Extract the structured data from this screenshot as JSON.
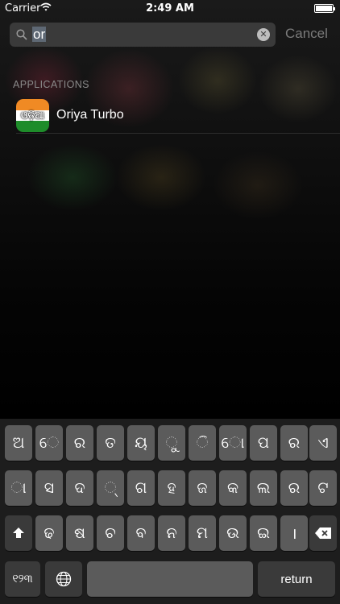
{
  "status_bar": {
    "carrier": "Carrier",
    "time": "2:49 AM"
  },
  "search": {
    "query": "or",
    "cancel_label": "Cancel"
  },
  "results": {
    "section_header": "APPLICATIONS",
    "items": [
      {
        "name": "Oriya Turbo",
        "icon_text": "ଓଡ଼ିଆ",
        "icon": "oriya-turbo-app-icon"
      }
    ]
  },
  "keyboard": {
    "row1": [
      "ଅ",
      "େ",
      "ର",
      "ତ",
      "ୟ",
      "ୁ",
      "ି",
      "ୋ",
      "ପ",
      "ର",
      "ଏ"
    ],
    "row2": [
      "ା",
      "ସ",
      "ଦ",
      "୍",
      "ଗ",
      "ହ",
      "ଜ",
      "କ",
      "ଲ",
      "ର",
      "ଟ"
    ],
    "row3": [
      "ଢ",
      "ଷ",
      "ଚ",
      "ବ",
      "ନ",
      "ମ",
      "ଉ",
      "ଇ",
      "।"
    ],
    "numbers_key": "୧୨୩",
    "return_label": "return",
    "icons": {
      "shift": "shift-icon",
      "delete": "delete-icon",
      "globe": "globe-icon"
    }
  }
}
